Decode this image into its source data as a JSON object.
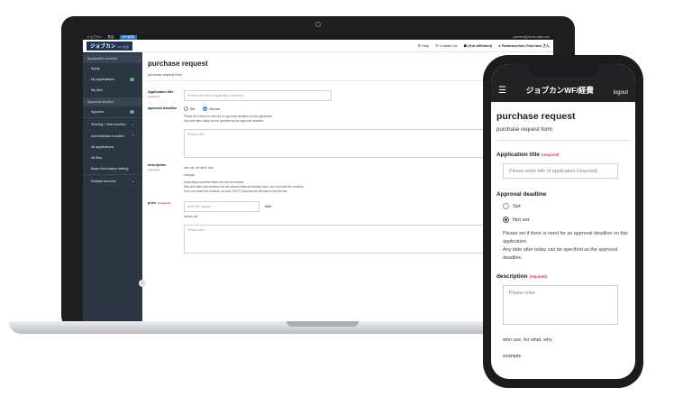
{
  "laptop": {
    "topbar": {
      "items": [
        "ジョブカン",
        "勤怠",
        "WF/経費"
      ],
      "right": "partner@jobcan-fake.com"
    },
    "logo": {
      "main": "ジョブカン",
      "sub": "WF/経費"
    },
    "header_links": [
      "Help",
      "Contact Us",
      "(Not affiliated)",
      "Pattaravichan Patchara さん"
    ],
    "sidebar": {
      "groups": [
        {
          "label": "Application function",
          "items": [
            {
              "label": "Apply",
              "badge": ""
            },
            {
              "label": "My applications",
              "badge": "0"
            },
            {
              "label": "My files",
              "badge": ""
            }
          ]
        },
        {
          "label": "Approval function",
          "items": [
            {
              "label": "Approve",
              "badge": "0"
            }
          ]
        }
      ],
      "sharing": "Sharing / View function",
      "admin": "Administrator function",
      "admin_items": [
        "All applications",
        "All files",
        "Basic information setting"
      ],
      "related": "Related services"
    },
    "form": {
      "title": "purchase request",
      "subtitle": "purchase request form",
      "app_title_label": "Application title",
      "required": "(required)",
      "app_title_placeholder": "Please enter title of application (required)",
      "deadline_label": "approval deadline",
      "set": "Set",
      "not_set": "Not set",
      "deadline_help1": "Please set if there is need for an approval deadline on this application.",
      "deadline_help2": "Any date after today can be specified as the approval deadline.",
      "textarea_placeholder": "Please enter",
      "description_label": "description",
      "desc_line1": "who use, for what, why",
      "desc_line2": "example",
      "desc_line3": "Especially production team will use the camera.",
      "desc_line4": "they will make new contents but the camera what we already have, can not make the contents.",
      "desc_line5": "If we can make the contents, we plan 12k PV /day and we will start to sell the ads.",
      "price_label": "price",
      "price_placeholder": "Enter the number",
      "price_unit": "Baht",
      "include_vat": "include vat"
    }
  },
  "phone": {
    "app_title": "ジョブカンWF/経費",
    "logout": "logout",
    "title": "purchase request",
    "subtitle": "purchase request form",
    "app_title_label": "Application title",
    "required": "(required)",
    "app_title_placeholder": "Please enter title of application (required)",
    "deadline_label": "Approval deadline",
    "set": "Set",
    "not_set": "Not set",
    "deadline_help1": "Please set if there is need for an approval deadline on this application.",
    "deadline_help2": "Any date after today can be specified as the approval deadline.",
    "description_label": "description",
    "textarea_placeholder": "Please enter",
    "desc_line1": "who use, for what, why",
    "desc_line2": "example"
  }
}
